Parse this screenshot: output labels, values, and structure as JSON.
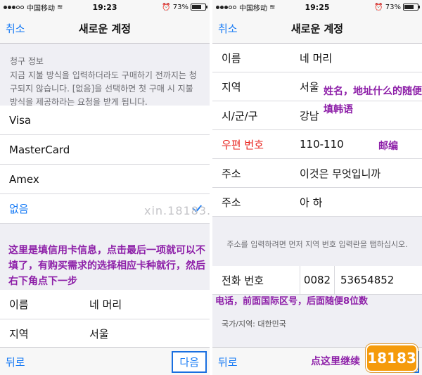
{
  "left": {
    "status": {
      "carrier": "中国移动",
      "time": "19:23",
      "battery": "73%"
    },
    "nav": {
      "cancel": "취소",
      "title": "새로운 계정"
    },
    "billing_header": "청구 정보",
    "billing_note": "지금 지불 방식을 입력하더라도 구매하기 전까지는 청구되지 않습니다. [없음]을 선택하면 첫 구매 시 지불 방식을 제공하라는 요청을 받게 됩니다.",
    "payment_options": [
      "Visa",
      "MasterCard",
      "Amex",
      "없음"
    ],
    "selected_option": "없음",
    "name_row": {
      "label": "이름",
      "value": "네 머리"
    },
    "region_row": {
      "label": "지역",
      "value": "서울"
    },
    "toolbar": {
      "back": "뒤로",
      "next": "다음"
    },
    "annotation": "这里是填信用卡信息，点击最后一项就可以不填了，有购买需求的选择相应卡种就行，然后右下角点下一步",
    "watermark": "xin.18183.com",
    "watermark2": "18183新游戏频道出品"
  },
  "right": {
    "status": {
      "carrier": "中国移动",
      "time": "19:25",
      "battery": "73%"
    },
    "nav": {
      "cancel": "취소",
      "title": "새로운 계정"
    },
    "rows": [
      {
        "label": "이름",
        "value": "네 머리"
      },
      {
        "label": "지역",
        "value": "서울"
      },
      {
        "label": "시/군/구",
        "value": "강남"
      },
      {
        "label": "우편 번호",
        "value": "110-110"
      },
      {
        "label": "주소",
        "value": "이것은 무엇입니까"
      },
      {
        "label": "주소",
        "value": "아 하"
      }
    ],
    "hint": "주소를 입력하려면 먼저 지역 번호 입력란을 탭하십시오.",
    "phone": {
      "label": "전화 번호",
      "country_code": "0082",
      "number": "53654852"
    },
    "country_line": "국가/지역: 대한민국",
    "toolbar": {
      "back": "뒤로",
      "next": "다음"
    },
    "annotations": {
      "name_address": "姓名，地址什么的随便填韩语",
      "postcode": "邮编",
      "phone": "电话，前面国际区号，后面随便8位数",
      "click_here": "点这里继续"
    },
    "logo": "18183"
  },
  "colors": {
    "accent": "#1a7cf5",
    "annotation": "#8d1fa8",
    "required_red": "#e8231d"
  }
}
